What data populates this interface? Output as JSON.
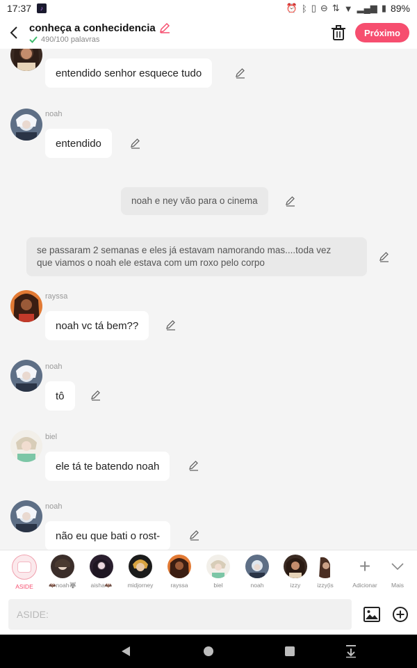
{
  "status": {
    "time": "17:37",
    "battery": "89%"
  },
  "header": {
    "title": "conheça a conhecidencia",
    "word_count": "490/100 palavras",
    "next_label": "Próximo"
  },
  "colors": {
    "accent": "#f64e6f",
    "check": "#3dbb6c"
  },
  "messages": [
    {
      "type": "message",
      "name": "",
      "text": "entendido senhor esquece tudo",
      "avatar": "rayssa-avatar"
    },
    {
      "type": "message",
      "name": "noah",
      "text": "entendido",
      "avatar": "noah-avatar"
    },
    {
      "type": "aside",
      "text": "noah e ney vão para o cinema"
    },
    {
      "type": "aside",
      "text_line1": "se passaram 2 semanas e eles já estavam namorando mas....toda vez",
      "text_line2": "que viamos o noah ele estava com um roxo pelo corpo"
    },
    {
      "type": "message",
      "name": "rayssa",
      "text": "noah vc tá bem??",
      "avatar": "rayssa-avatar"
    },
    {
      "type": "message",
      "name": "noah",
      "text": "tô",
      "avatar": "noah-avatar"
    },
    {
      "type": "message",
      "name": "biel",
      "text": "ele tá te batendo noah",
      "avatar": "biel-avatar"
    },
    {
      "type": "message",
      "name": "noah",
      "text": "não eu que bati o rost-",
      "avatar": "noah-avatar"
    }
  ],
  "characters": [
    {
      "label": "ASIDE",
      "selected": true
    },
    {
      "label": "🦇noah🐺"
    },
    {
      "label": "aisha🦇"
    },
    {
      "label": "midjorney"
    },
    {
      "label": "rayssa"
    },
    {
      "label": "biel"
    },
    {
      "label": "noah"
    },
    {
      "label": "izzy"
    },
    {
      "label": "izzy(is"
    }
  ],
  "char_actions": {
    "add_label": "Adicionar",
    "more_label": "Mais"
  },
  "input": {
    "placeholder": "ASIDE:"
  }
}
